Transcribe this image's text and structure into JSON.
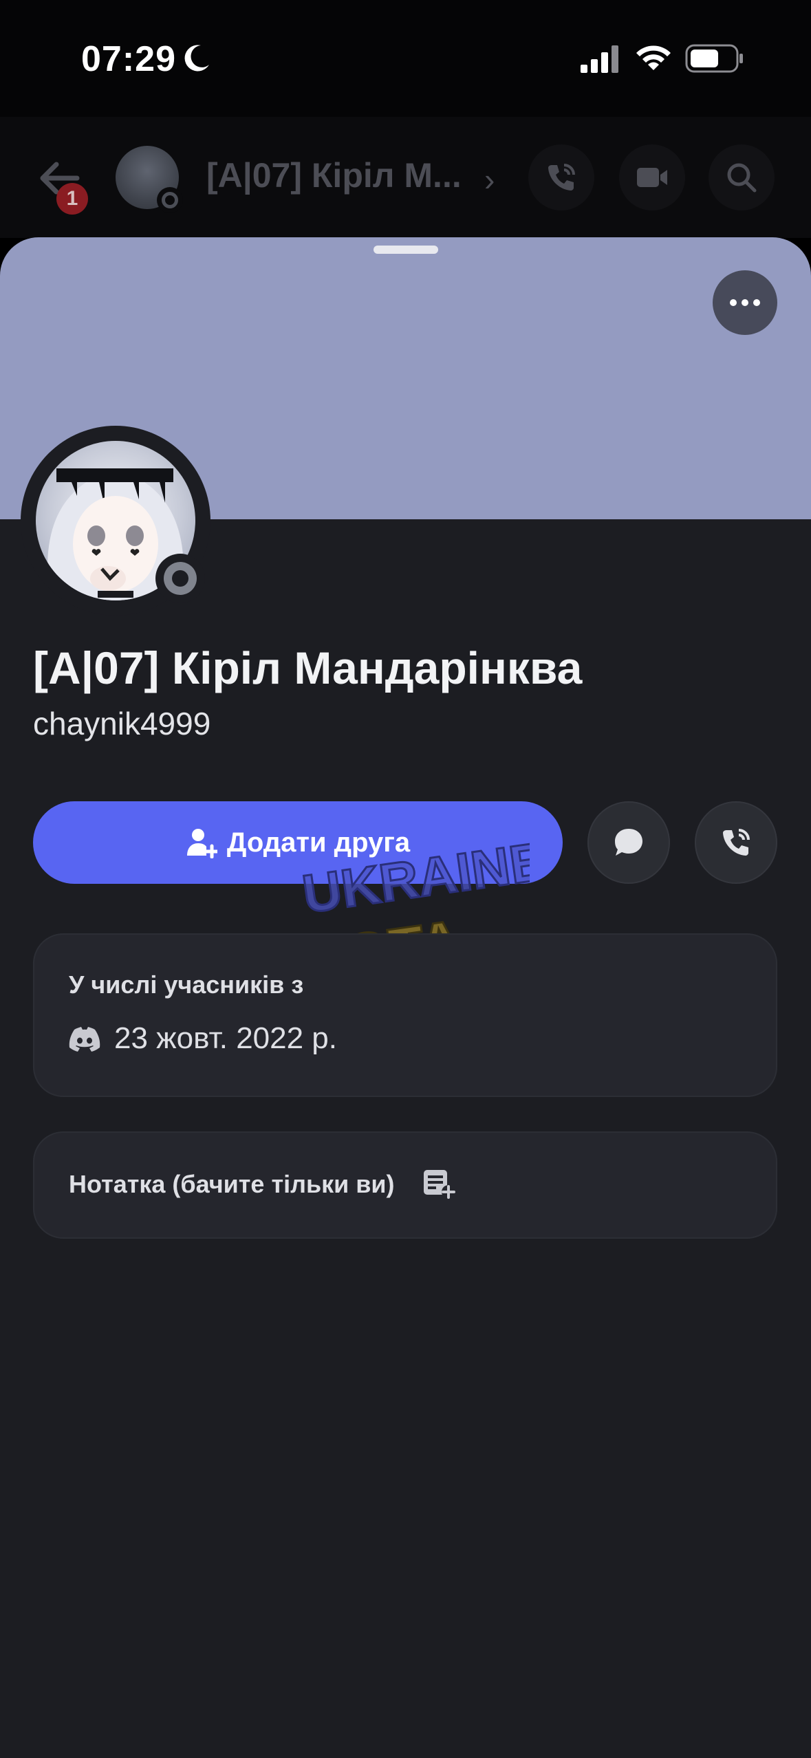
{
  "status_bar": {
    "time": "07:29"
  },
  "chat_header": {
    "unread_badge": "1",
    "title": "[A|07] Кіріл М...",
    "chevron": "›"
  },
  "profile": {
    "display_name": "[A|07] Кіріл Мандарінква",
    "username": "chaynik4999",
    "banner_color": "#949bc1",
    "status": "offline"
  },
  "actions": {
    "add_friend_label": "Додати друга"
  },
  "member_since": {
    "label": "У числі учасників з",
    "date": "23 жовт. 2022 р."
  },
  "note": {
    "label": "Нотатка (бачите тільки ви)"
  },
  "watermark": {
    "line1": "UKRAINE",
    "line2": "GTA"
  },
  "colors": {
    "accent": "#5865f2",
    "background": "#1c1d22",
    "card": "#25262d"
  }
}
